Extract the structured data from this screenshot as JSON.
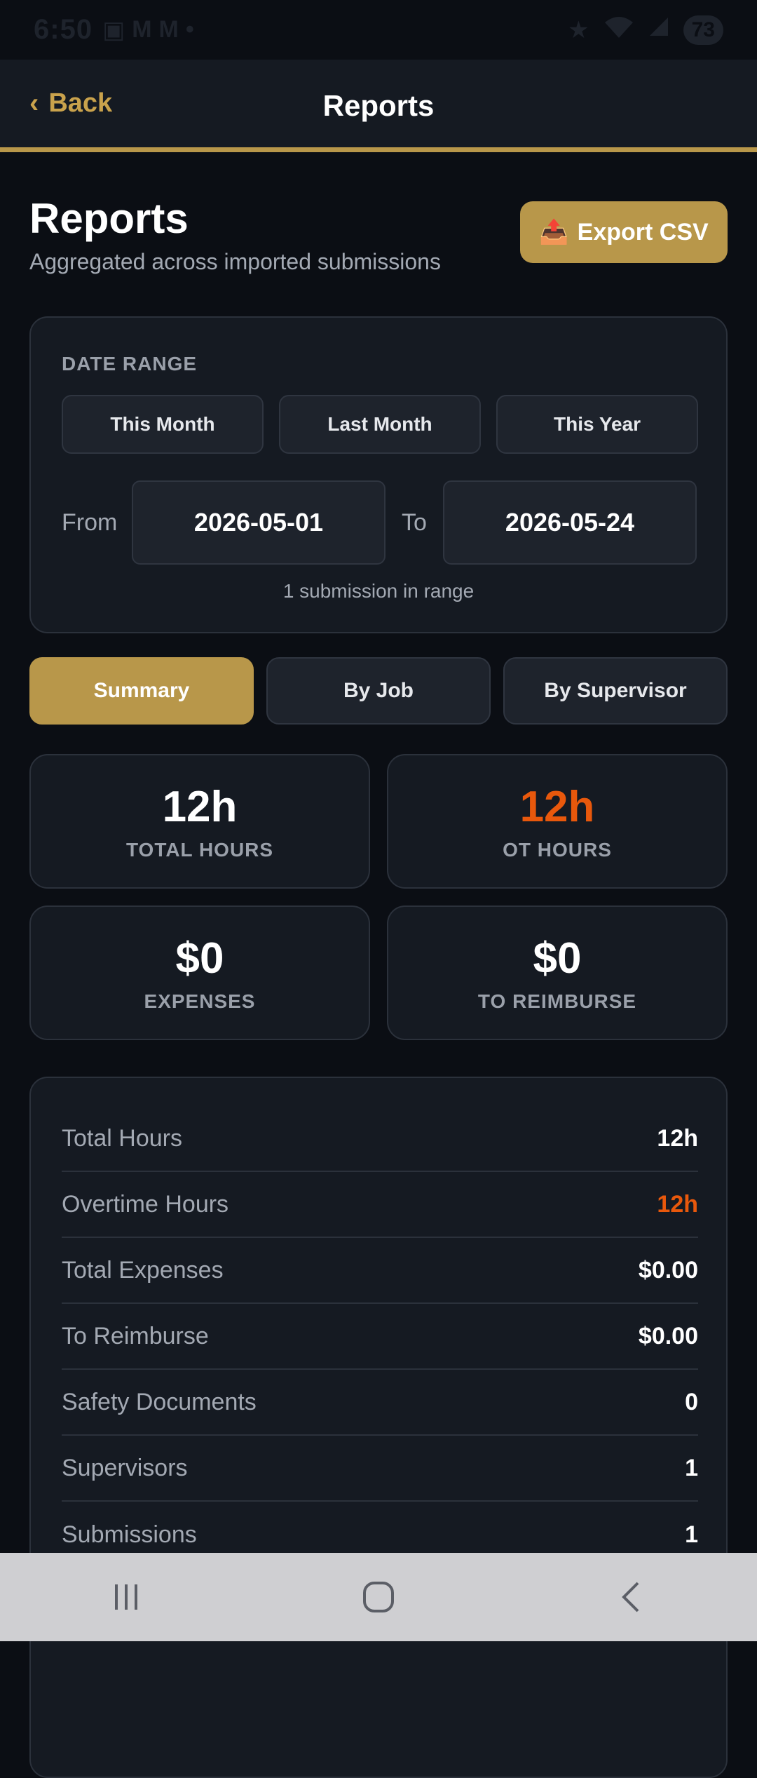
{
  "status_bar": {
    "time": "6:50",
    "battery": "73"
  },
  "app_bar": {
    "back_label": "Back",
    "title": "Reports"
  },
  "header": {
    "title": "Reports",
    "subtitle": "Aggregated across imported submissions",
    "export_label": "Export CSV",
    "export_icon": "outbox-tray-icon"
  },
  "date_range": {
    "section_label": "DATE RANGE",
    "presets": [
      "This Month",
      "Last Month",
      "This Year"
    ],
    "from_label": "From",
    "from_value": "2026-05-01",
    "to_label": "To",
    "to_value": "2026-05-24",
    "count_text": "1 submission in range"
  },
  "tabs": [
    {
      "label": "Summary",
      "active": true
    },
    {
      "label": "By Job",
      "active": false
    },
    {
      "label": "By Supervisor",
      "active": false
    }
  ],
  "stats": [
    {
      "value": "12h",
      "label": "TOTAL HOURS",
      "highlight": false
    },
    {
      "value": "12h",
      "label": "OT HOURS",
      "highlight": true
    },
    {
      "value": "$0",
      "label": "EXPENSES",
      "highlight": false
    },
    {
      "value": "$0",
      "label": "TO REIMBURSE",
      "highlight": false
    }
  ],
  "summary": [
    {
      "label": "Total Hours",
      "value": "12h",
      "highlight": false
    },
    {
      "label": "Overtime Hours",
      "value": "12h",
      "highlight": true
    },
    {
      "label": "Total Expenses",
      "value": "$0.00",
      "highlight": false
    },
    {
      "label": "To Reimburse",
      "value": "$0.00",
      "highlight": false
    },
    {
      "label": "Safety Documents",
      "value": "0",
      "highlight": false
    },
    {
      "label": "Supervisors",
      "value": "1",
      "highlight": false
    },
    {
      "label": "Submissions",
      "value": "1",
      "highlight": false
    }
  ],
  "colors": {
    "accent": "#b8974a",
    "overtime": "#e8580c",
    "background": "#0b0e14",
    "card": "#151a22"
  }
}
